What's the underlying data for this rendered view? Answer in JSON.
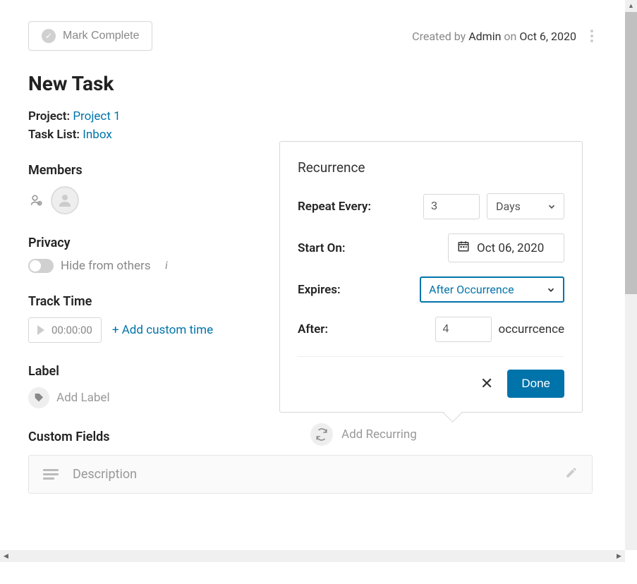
{
  "header": {
    "mark_complete_label": "Mark Complete",
    "created_by_prefix": "Created by",
    "created_by_user": "Admin",
    "created_on_prefix": "on",
    "created_on_date": "Oct 6, 2020"
  },
  "task": {
    "title": "New Task",
    "project_label": "Project:",
    "project_value": "Project 1",
    "tasklist_label": "Task List:",
    "tasklist_value": "Inbox"
  },
  "members": {
    "heading": "Members"
  },
  "privacy": {
    "heading": "Privacy",
    "label": "Hide from others"
  },
  "track_time": {
    "heading": "Track Time",
    "value": "00:00:00",
    "add_custom": "+ Add custom time"
  },
  "label": {
    "heading": "Label",
    "add_label": "Add Label"
  },
  "custom_fields": {
    "heading": "Custom Fields",
    "description_placeholder": "Description"
  },
  "recurring": {
    "add_recurring": "Add Recurring"
  },
  "recurrence_popup": {
    "title": "Recurrence",
    "repeat_every_label": "Repeat Every:",
    "repeat_every_value": "3",
    "repeat_unit": "Days",
    "start_on_label": "Start On:",
    "start_on_value": "Oct 06, 2020",
    "expires_label": "Expires:",
    "expires_value": "After Occurrence",
    "after_label": "After:",
    "after_value": "4",
    "occurrence_text": "occurrcence",
    "done_label": "Done"
  }
}
